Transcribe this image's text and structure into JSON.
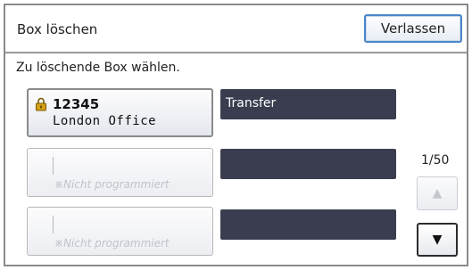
{
  "dialog": {
    "title": "Box löschen",
    "exit_label": "Verlassen",
    "instruction": "Zu löschende Box wählen."
  },
  "boxes": [
    {
      "number": "12345",
      "name": "London Office",
      "document": "Transfer",
      "locked": true,
      "programmed": true
    },
    {
      "number": "",
      "name": "",
      "empty_label": "※Nicht programmiert",
      "document": "",
      "locked": false,
      "programmed": false
    },
    {
      "number": "",
      "name": "",
      "empty_label": "※Nicht programmiert",
      "document": "",
      "locked": false,
      "programmed": false
    }
  ],
  "pagination": {
    "indicator": "1/50",
    "up_enabled": false,
    "down_enabled": true,
    "up_icon": "triangle-up-icon",
    "down_icon": "triangle-down-icon"
  },
  "colors": {
    "accent_border": "#4a86c8",
    "document_field": "#3a3d4f",
    "lock_icon": "#d4a017"
  }
}
